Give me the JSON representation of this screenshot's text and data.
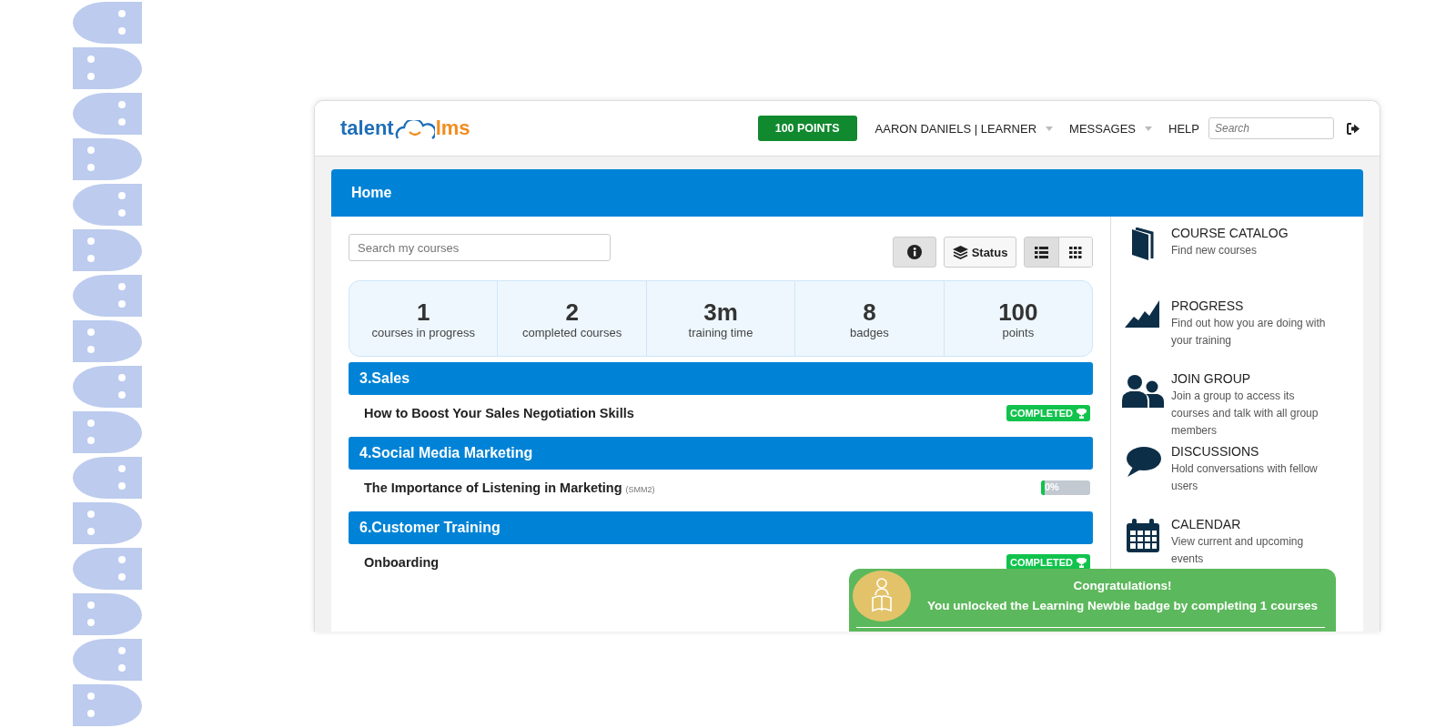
{
  "header": {
    "logo_left": "talent",
    "logo_right": "lms",
    "points_button": "100 POINTS",
    "user_menu": "AARON DANIELS | LEARNER",
    "messages_menu": "MESSAGES",
    "help_link": "HELP",
    "search": {
      "placeholder": "Search"
    }
  },
  "page_title": "Home",
  "course_search": {
    "placeholder": "Search my courses"
  },
  "status_button": "Status",
  "view_toggles": [
    {
      "kind": "list",
      "selected": true
    },
    {
      "kind": "grid",
      "selected": false
    }
  ],
  "stats": [
    {
      "value": "1",
      "label": "courses in progress"
    },
    {
      "value": "2",
      "label": "completed courses"
    },
    {
      "value": "3m",
      "label": "training time"
    },
    {
      "value": "8",
      "label": "badges"
    },
    {
      "value": "100",
      "label": "points"
    }
  ],
  "categories": [
    {
      "title": "3.Sales",
      "courses": [
        {
          "name": "How to Boost Your Sales Negotiation Skills",
          "kind": "completed",
          "status": "COMPLETED"
        }
      ]
    },
    {
      "title": "4.Social Media Marketing",
      "courses": [
        {
          "name": "The Importance of Listening in Marketing",
          "code": "(SMM2)",
          "kind": "progress",
          "level": 0,
          "reading": "0%"
        }
      ]
    },
    {
      "title": "6.Customer Training",
      "courses": [
        {
          "name": "Onboarding",
          "kind": "completed",
          "status": "COMPLETED"
        }
      ]
    }
  ],
  "sidebar": {
    "items": [
      {
        "kind": "book",
        "title": "COURSE CATALOG",
        "description": "Find new courses"
      },
      {
        "kind": "chart",
        "title": "PROGRESS",
        "description": "Find out how you are doing with your training"
      },
      {
        "kind": "group",
        "title": "JOIN GROUP",
        "description": "Join a group to access its courses and talk with all group members"
      },
      {
        "kind": "chat",
        "title": "DISCUSSIONS",
        "description": "Hold conversations with fellow users"
      },
      {
        "kind": "calendar",
        "title": "CALENDAR",
        "description": "View current and upcoming events"
      }
    ]
  },
  "toast": {
    "title": "Congratulations!",
    "message": "You unlocked the Learning Newbie badge by completing 1 courses"
  }
}
